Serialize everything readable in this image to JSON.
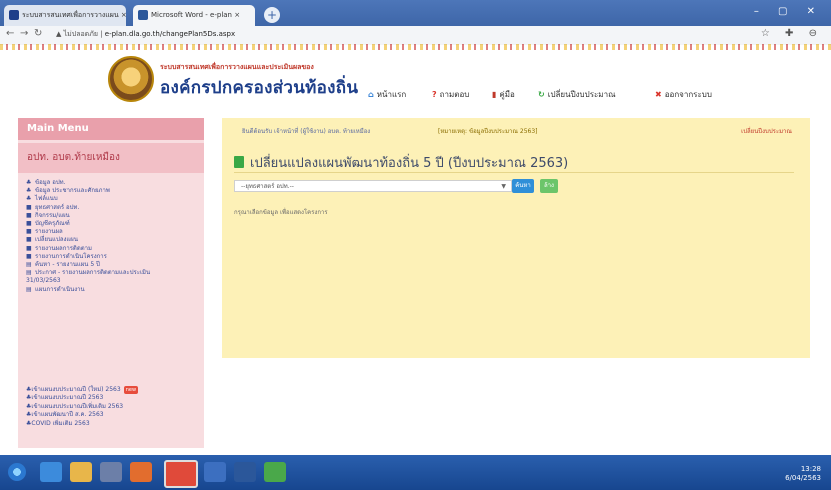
{
  "browser": {
    "tabs": [
      {
        "label": "ระบบสารสนเทศเพื่อการวางแผน ×"
      },
      {
        "label": "Microsoft Word - e-plan ×"
      }
    ],
    "new_tab": "+",
    "url_security": "ไม่ปลอดภัย",
    "url_text": "e-plan.dla.go.th/changePlan5Ds.aspx"
  },
  "header": {
    "org_subtitle": "ระบบสารสนเทศเพื่อการวางแผนและประเมินผลของ",
    "org_title": "องค์กรปกครองส่วนท้องถิ่น",
    "nav": [
      {
        "icon": "home-icon",
        "label": "หน้าแรก",
        "color": "#2a7bd4",
        "glyph": "⌂"
      },
      {
        "icon": "question-icon",
        "label": "ถามตอบ",
        "color": "#d9342b",
        "glyph": "?"
      },
      {
        "icon": "book-icon",
        "label": "คู่มือ",
        "color": "#c0392b",
        "glyph": "▮"
      },
      {
        "icon": "refresh-icon",
        "label": "เปลี่ยนปีงบประมาณ",
        "color": "#3aa845",
        "glyph": "↻"
      },
      {
        "icon": "close-icon",
        "label": "ออกจากระบบ",
        "color": "#d9342b",
        "glyph": "✖"
      }
    ]
  },
  "sidebar": {
    "menu_title": "Main Menu",
    "org_name": "อปท. อบต.ท้ายเหมือง",
    "items": [
      "ข้อมูล อปท.",
      "ข้อมูล ประชากรและศักยภาพ",
      "ไฟล์แนบ",
      "ยุทธศาสตร์ อปท.",
      "กิจกรรม/แผน",
      "บัญชีครุภัณฑ์",
      "รายงานผล",
      "เปลี่ยนแปลงแผน",
      "รายงานผลการติดตาม",
      "รายงานการดำเนินโครงการ",
      "ค้นหา - รายงานแผน 5 ปี",
      "ประกาศ - รายงานผลการติดตามและประเมิน",
      "31/03/2563",
      "แผนการดำเนินงาน"
    ],
    "bottom_items": [
      {
        "label": "เข้าแผนงบประมาณปี (ใหม่) 2563",
        "tag": "new"
      },
      {
        "label": "เข้าแผนงบประมาณปี 2563",
        "tag": ""
      },
      {
        "label": "เข้าแผนงบประมาณปีเพิ่มเติม 2563",
        "tag": ""
      },
      {
        "label": "เข้าแผนพัฒนาปี ส.ค. 2563",
        "tag": ""
      },
      {
        "label": "COVID เพิ่มเติม 2563",
        "tag": ""
      }
    ]
  },
  "main": {
    "breadcrumb_left": "ยินดีต้อนรับ เจ้าหน้าที่ (ผู้ใช้งาน) อบต. ท้ายเหมือง",
    "breadcrumb_mid": "[หมายเหตุ: ข้อมูลปีงบประมาณ 2563]",
    "breadcrumb_right": "เปลี่ยนปีงบประมาณ",
    "title": "เปลี่ยนแปลงแผนพัฒนาท้องถิ่น 5 ปี (ปีงบประมาณ 2563)",
    "select_value": "--ยุทธศาสตร์ อปท.--",
    "search_button": "ค้นหา",
    "clear_button": "ล้าง",
    "note": "กรุณาเลือกข้อมูล เพื่อแสดงโครงการ"
  },
  "taskbar": {
    "time": "13:28",
    "date": "6/04/2563"
  }
}
